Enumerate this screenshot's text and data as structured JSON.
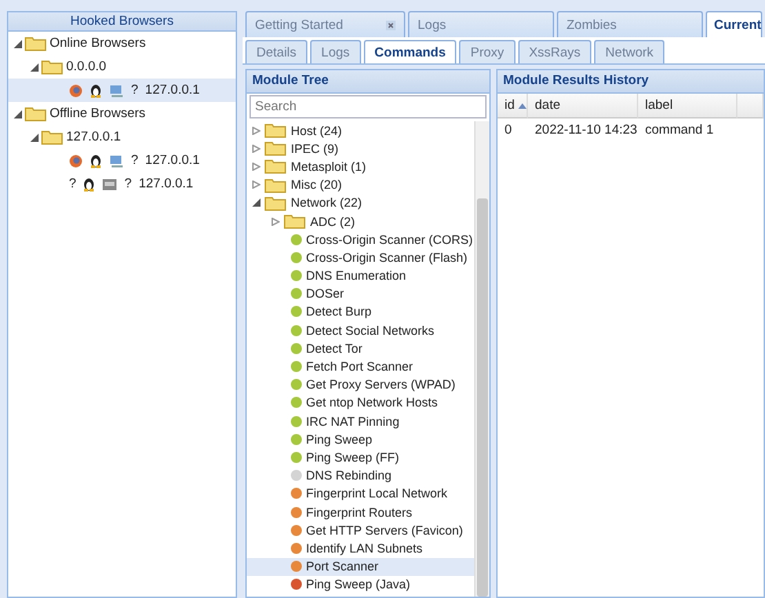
{
  "hooked_browsers": {
    "title": "Hooked Browsers",
    "groups": [
      {
        "label": "Online Browsers",
        "expanded": true,
        "children": [
          {
            "label": "0.0.0.0",
            "expanded": true,
            "browsers": [
              {
                "selected": true,
                "icons": [
                  {
                    "kind": "firefox"
                  },
                  {
                    "kind": "linux"
                  },
                  {
                    "kind": "desktop"
                  },
                  {
                    "kind": "glyph",
                    "text": "?"
                  }
                ],
                "ip": "127.0.0.1"
              }
            ]
          }
        ]
      },
      {
        "label": "Offline Browsers",
        "expanded": true,
        "children": [
          {
            "label": "127.0.0.1",
            "expanded": true,
            "browsers": [
              {
                "selected": false,
                "icons": [
                  {
                    "kind": "firefox"
                  },
                  {
                    "kind": "linux"
                  },
                  {
                    "kind": "desktop"
                  },
                  {
                    "kind": "glyph",
                    "text": "?"
                  }
                ],
                "ip": "127.0.0.1"
              },
              {
                "selected": false,
                "icons": [
                  {
                    "kind": "glyph",
                    "text": "?"
                  },
                  {
                    "kind": "linux"
                  },
                  {
                    "kind": "vm"
                  },
                  {
                    "kind": "glyph",
                    "text": "?"
                  }
                ],
                "ip": "127.0.0.1"
              }
            ]
          }
        ]
      }
    ]
  },
  "main_tabs": [
    {
      "label": "Getting Started",
      "selected": false,
      "closable": true
    },
    {
      "label": "Logs",
      "selected": false,
      "closable": false
    },
    {
      "label": "Zombies",
      "selected": false,
      "closable": false
    },
    {
      "label": "Current",
      "selected": true,
      "closable": false
    }
  ],
  "sub_tabs": [
    {
      "label": "Details",
      "selected": false
    },
    {
      "label": "Logs",
      "selected": false
    },
    {
      "label": "Commands",
      "selected": true
    },
    {
      "label": "Proxy",
      "selected": false
    },
    {
      "label": "XssRays",
      "selected": false
    },
    {
      "label": "Network",
      "selected": false
    }
  ],
  "module_tree": {
    "title": "Module Tree",
    "search": {
      "placeholder": "Search"
    },
    "items": [
      {
        "kind": "folder",
        "label": "Host (24)",
        "expanded": false,
        "selected": false
      },
      {
        "kind": "folder",
        "label": "IPEC (9)",
        "expanded": false,
        "selected": false
      },
      {
        "kind": "folder",
        "label": "Metasploit (1)",
        "expanded": false,
        "selected": false
      },
      {
        "kind": "folder",
        "label": "Misc (20)",
        "expanded": false,
        "selected": false
      },
      {
        "kind": "folder",
        "label": "Network (22)",
        "expanded": true,
        "selected": false,
        "children": [
          {
            "kind": "folder",
            "label": "ADC (2)",
            "expanded": false,
            "selected": false
          },
          {
            "kind": "module",
            "label": "Cross-Origin Scanner (CORS)",
            "color": "#a6c83c",
            "selected": false
          },
          {
            "kind": "module",
            "label": "Cross-Origin Scanner (Flash)",
            "color": "#a6c83c",
            "selected": false
          },
          {
            "kind": "module",
            "label": "DNS Enumeration",
            "color": "#a6c83c",
            "selected": false
          },
          {
            "kind": "module",
            "label": "DOSer",
            "color": "#a6c83c",
            "selected": false
          },
          {
            "kind": "module",
            "label": "Detect Burp",
            "color": "#a6c83c",
            "selected": false
          },
          {
            "kind": "module",
            "label": "Detect Social Networks",
            "color": "#a6c83c",
            "selected": false
          },
          {
            "kind": "module",
            "label": "Detect Tor",
            "color": "#a6c83c",
            "selected": false
          },
          {
            "kind": "module",
            "label": "Fetch Port Scanner",
            "color": "#a6c83c",
            "selected": false
          },
          {
            "kind": "module",
            "label": "Get Proxy Servers (WPAD)",
            "color": "#a6c83c",
            "selected": false
          },
          {
            "kind": "module",
            "label": "Get ntop Network Hosts",
            "color": "#a6c83c",
            "selected": false
          },
          {
            "kind": "module",
            "label": "IRC NAT Pinning",
            "color": "#a6c83c",
            "selected": false
          },
          {
            "kind": "module",
            "label": "Ping Sweep",
            "color": "#a6c83c",
            "selected": false
          },
          {
            "kind": "module",
            "label": "Ping Sweep (FF)",
            "color": "#a6c83c",
            "selected": false
          },
          {
            "kind": "module",
            "label": "DNS Rebinding",
            "color": "#d4d4d4",
            "selected": false
          },
          {
            "kind": "module",
            "label": "Fingerprint Local Network",
            "color": "#e8883a",
            "selected": false
          },
          {
            "kind": "module",
            "label": "Fingerprint Routers",
            "color": "#e8883a",
            "selected": false
          },
          {
            "kind": "module",
            "label": "Get HTTP Servers (Favicon)",
            "color": "#e8883a",
            "selected": false
          },
          {
            "kind": "module",
            "label": "Identify LAN Subnets",
            "color": "#e8883a",
            "selected": false
          },
          {
            "kind": "module",
            "label": "Port Scanner",
            "color": "#e8883a",
            "selected": true
          },
          {
            "kind": "module",
            "label": "Ping Sweep (Java)",
            "color": "#d9552f",
            "selected": false
          }
        ]
      }
    ]
  },
  "results": {
    "title": "Module Results History",
    "columns": [
      {
        "label": "id",
        "sorted": true
      },
      {
        "label": "date",
        "sorted": false
      },
      {
        "label": "label",
        "sorted": false
      }
    ],
    "rows": [
      [
        "0",
        "2022-11-10 14:23",
        "command 1"
      ]
    ]
  }
}
